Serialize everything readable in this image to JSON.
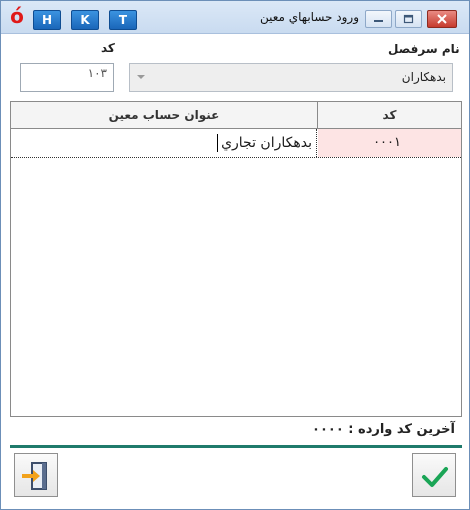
{
  "titlebar": {
    "app_logo": "ó",
    "title": "ورود حسابهاي معين",
    "hotkeys": [
      "H",
      "K",
      "T"
    ]
  },
  "form": {
    "code_label": "کد",
    "code_value": "۱۰۳",
    "group_label": "نام سرفصل",
    "group_value": "بدهکاران"
  },
  "grid": {
    "columns": [
      "عنوان حساب معين",
      "کد"
    ],
    "rows": [
      {
        "title": "بدهکاران تجاري",
        "code": "۰۰۰۱"
      }
    ]
  },
  "status": {
    "last_code_text": "آخرين کد وارده : ۰۰۰۰"
  },
  "icons": {
    "confirm": "check-icon",
    "exit": "exit-door-icon"
  },
  "colors": {
    "accent": "#1f7a6b",
    "row_code_bg": "#fde4e4",
    "confirm": "#1aa556",
    "exit_arrow": "#f2a21b"
  }
}
